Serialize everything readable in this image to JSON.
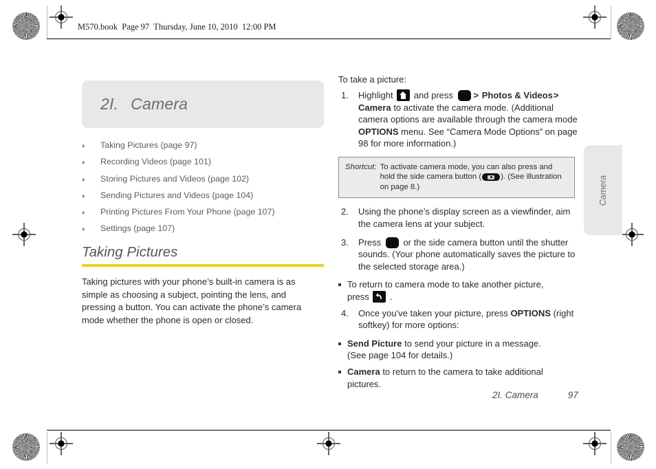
{
  "header": {
    "book_line": "M570.book  Page 97  Thursday, June 10, 2010  12:00 PM"
  },
  "chapter": {
    "number": "2I.",
    "title": "Camera"
  },
  "toc": {
    "bullet": "♦",
    "items": [
      "Taking Pictures (page 97)",
      "Recording Videos (page 101)",
      "Storing Pictures and Videos (page 102)",
      "Sending Pictures and Videos (page 104)",
      "Printing Pictures From Your Phone (page 107)",
      "Settings (page 107)"
    ]
  },
  "section": {
    "heading": "Taking Pictures",
    "rule_color": "#e8d41e",
    "paragraph": "Taking pictures with your phone’s built-in camera is as simple as choosing a subject, pointing the lens, and pressing a button. You can activate the phone’s camera mode whether the phone is open or closed."
  },
  "procedure": {
    "lead": "To take a picture:",
    "step1": {
      "number": "1.",
      "t1": "Highlight ",
      "icon1": "home-key-icon",
      "t2": " and press ",
      "icon2": "ok-key-icon",
      "chev1": ">",
      "b1": "Photos & Videos",
      "chev2": ">",
      "b2": "Camera",
      "t3": " to activate the camera mode. (Additional camera options are available through the camera mode ",
      "b3": "OPTIONS",
      "t4": " menu. See “Camera Mode Options” on page 98 for more information.)"
    },
    "shortcut": {
      "label": "Shortcut:",
      "t1": "To activate camera mode, you can also press and hold the side camera button (",
      "icon": "side-camera-button-icon",
      "t2": "). (See illustration on page 8.)"
    },
    "step2": {
      "number": "2.",
      "text": "Using the phone’s display screen as a viewfinder, aim the camera lens at your subject."
    },
    "step3": {
      "number": "3.",
      "t1": "Press ",
      "icon": "ok-key-icon",
      "t2": " or the side camera button until the shutter sounds. (Your phone automatically saves the picture to the selected storage area.)",
      "sub": {
        "t1": "To return to camera mode to take another picture, press ",
        "icon": "back-key-icon",
        "t2": " ."
      }
    },
    "step4": {
      "number": "4.",
      "t1": "Once you've taken your picture, press ",
      "b1": "OPTIONS",
      "t2": " (right softkey) for more options:",
      "subs": [
        {
          "bold": "Send Picture",
          "rest": " to send your picture in a message. (See page 104 for details.)"
        },
        {
          "bold": "Camera",
          "rest": " to return to the camera to take additional pictures."
        }
      ]
    }
  },
  "side_tab": {
    "label": "Camera"
  },
  "footer": {
    "chapter": "2I. Camera",
    "page": "97"
  }
}
